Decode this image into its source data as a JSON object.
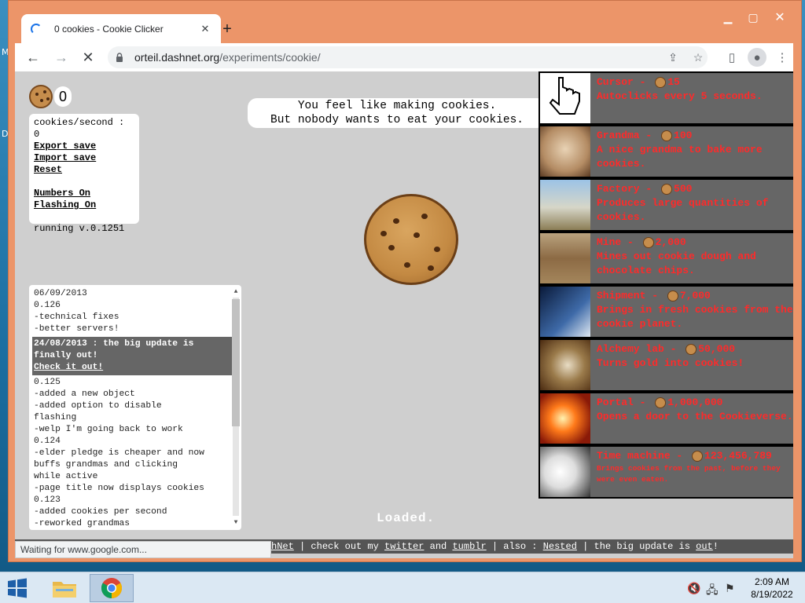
{
  "browser": {
    "tab_title": "0 cookies - Cookie Clicker",
    "url_host": "orteil.dashnet.org",
    "url_path": "/experiments/cookie/",
    "status_text": "Waiting for www.google.com..."
  },
  "game": {
    "cookie_count": "0",
    "stats": {
      "cps": "cookies/second : 0",
      "export": "Export save",
      "import": "Import save",
      "reset": "Reset",
      "numbers": "Numbers On",
      "flashing": "Flashing On",
      "version": "running v.0.1251"
    },
    "message_line1": "You feel like making cookies.",
    "message_line2": "But nobody wants to eat your cookies.",
    "loaded_text": "Loaded.",
    "changelog": {
      "lines_before": [
        "06/09/2013",
        "0.126",
        "-technical fixes",
        "-better servers!"
      ],
      "highlight_line1": "24/08/2013 : the big update is",
      "highlight_line2": "finally out!",
      "highlight_link": "Check it out!",
      "lines_after": [
        "0.125",
        "-added a new object",
        "-added option to disable",
        "flashing",
        "-welp I'm going back to work",
        "0.124",
        "-elder pledge is cheaper and now",
        "buffs grandmas and clicking",
        "while active",
        "-page title now displays cookies",
        "0.123",
        "-added cookies per second",
        "-reworked grandmas"
      ]
    },
    "store": [
      {
        "name": "Cursor",
        "price": "15",
        "desc": "Autoclicks every 5 seconds.",
        "icon": "cursor-icon"
      },
      {
        "name": "Grandma",
        "price": "100",
        "desc": "A nice grandma to bake more cookies.",
        "icon": "grandma-icon"
      },
      {
        "name": "Factory",
        "price": "500",
        "desc": "Produces large quantities of cookies.",
        "icon": "factory-icon"
      },
      {
        "name": "Mine",
        "price": "2,000",
        "desc": "Mines out cookie dough and chocolate chips.",
        "icon": "mine-icon"
      },
      {
        "name": "Shipment",
        "price": "7,000",
        "desc": "Brings in fresh cookies from the cookie planet.",
        "icon": "shipment-icon"
      },
      {
        "name": "Alchemy lab",
        "price": "50,000",
        "desc": "Turns gold into cookies!",
        "icon": "alchemy-lab-icon"
      },
      {
        "name": "Portal",
        "price": "1,000,000",
        "desc": "Opens a door to the Cookieverse.",
        "icon": "portal-icon"
      },
      {
        "name": "Time machine",
        "price": "123,456,789",
        "desc": "Brings cookies from the past, before they were even eaten.",
        "icon": "time-machine-icon"
      }
    ],
    "footer": {
      "dashnet_partial": "hNet",
      "sep1": " | check out my ",
      "twitter": "twitter",
      "and": " and ",
      "tumblr": "tumblr",
      "sep2": " | also : ",
      "nested": "Nested",
      "sep3": " | the big update is ",
      "out": "out",
      "end": "!"
    }
  },
  "taskbar": {
    "time": "2:09 AM",
    "date": "8/19/2022"
  }
}
